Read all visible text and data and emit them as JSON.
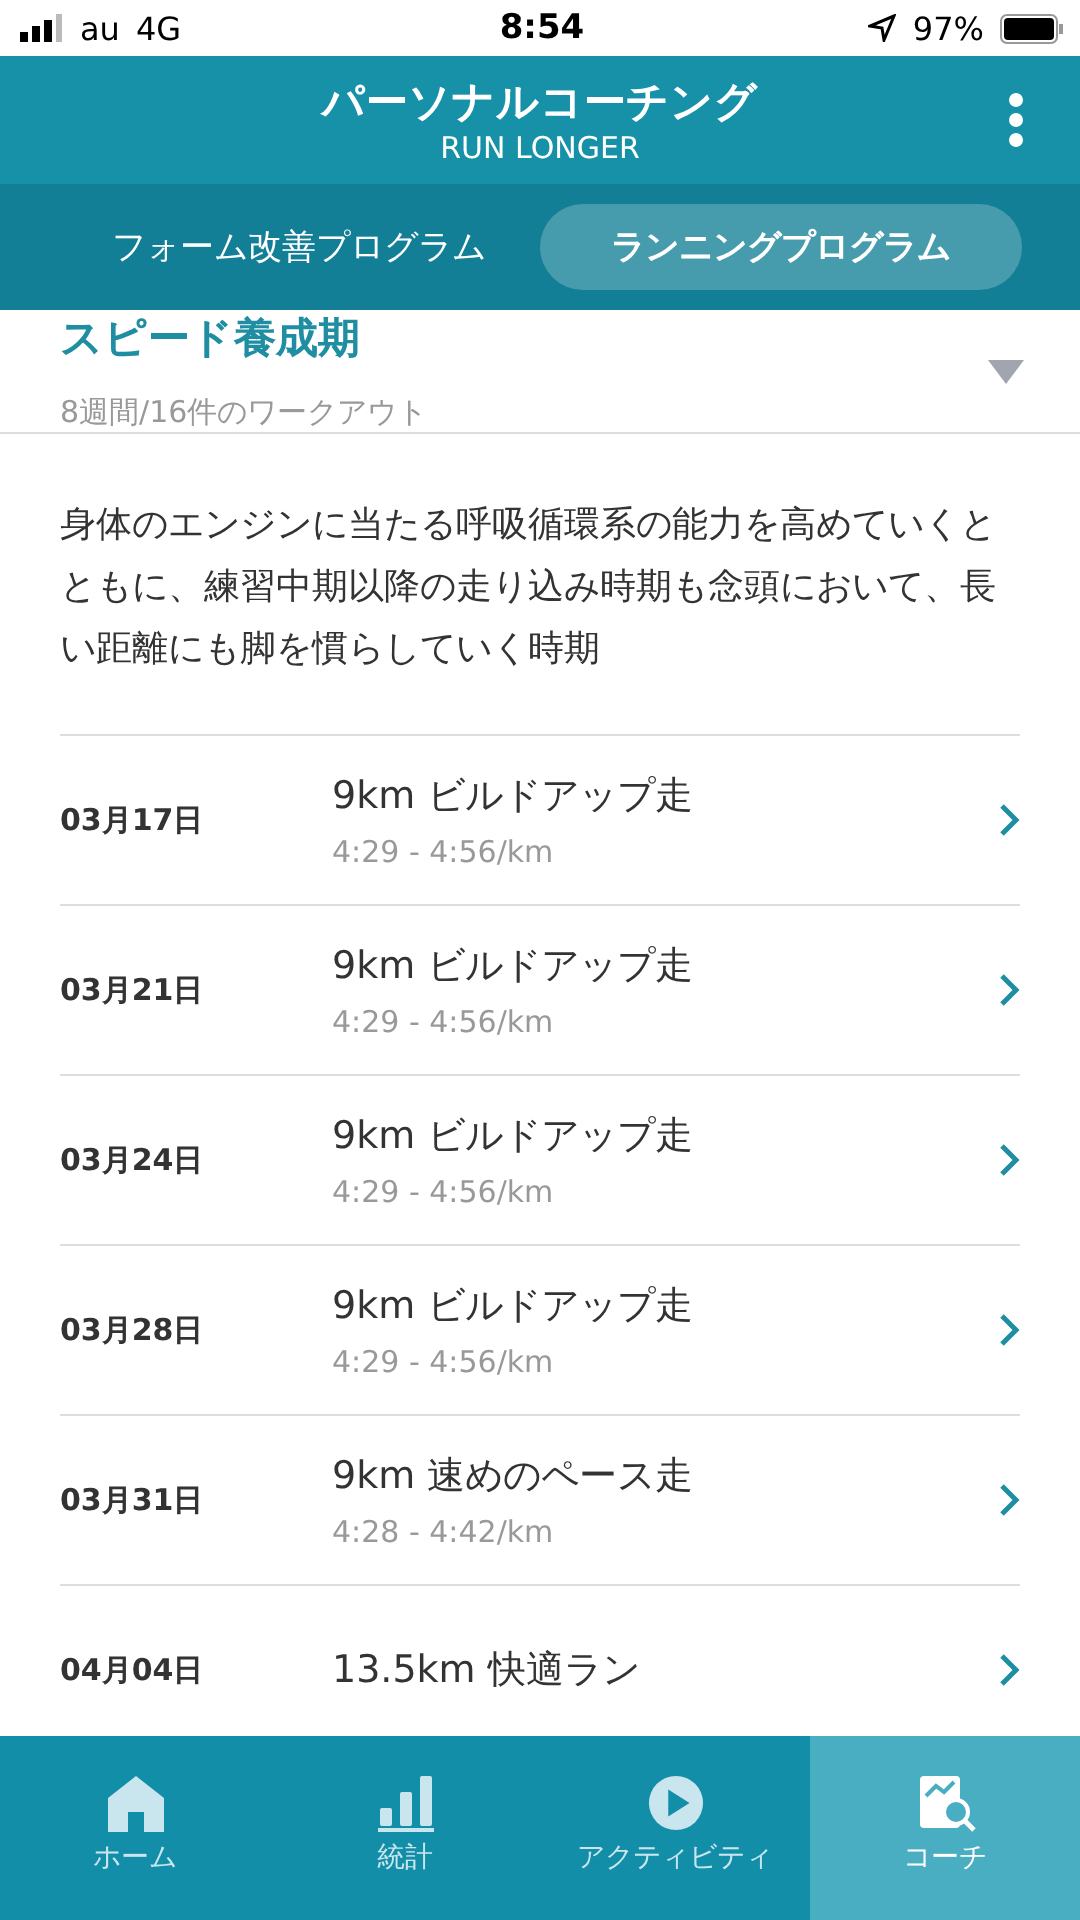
{
  "status_bar": {
    "carrier": "au",
    "network": "4G",
    "time": "8:54",
    "battery": "97%"
  },
  "header": {
    "title": "パーソナルコーチング",
    "subtitle": "RUN LONGER"
  },
  "tabs": [
    {
      "label": "フォーム改善プログラム",
      "selected": false
    },
    {
      "label": "ランニングプログラム",
      "selected": true
    }
  ],
  "phase": {
    "title": "スピード養成期",
    "summary": "8週間/16件のワークアウト",
    "expanded": false,
    "description": "身体のエンジンに当たる呼吸循環系の能力を高めていくとともに、練習中期以降の走り込み時期も念頭において、長い距離にも脚を慣らしていく時期"
  },
  "workouts": [
    {
      "date": "03月17日",
      "title": "9km ビルドアップ走",
      "pace": "4:29 - 4:56/km"
    },
    {
      "date": "03月21日",
      "title": "9km ビルドアップ走",
      "pace": "4:29 - 4:56/km"
    },
    {
      "date": "03月24日",
      "title": "9km ビルドアップ走",
      "pace": "4:29 - 4:56/km"
    },
    {
      "date": "03月28日",
      "title": "9km ビルドアップ走",
      "pace": "4:29 - 4:56/km"
    },
    {
      "date": "03月31日",
      "title": "9km 速めのペース走",
      "pace": "4:28 - 4:42/km"
    },
    {
      "date": "04月04日",
      "title": "13.5km 快適ラン"
    }
  ],
  "bottom_nav": [
    {
      "kind": "home",
      "label": "ホーム",
      "selected": false
    },
    {
      "kind": "stats",
      "label": "統計",
      "selected": false
    },
    {
      "kind": "activity",
      "label": "アクティビティ",
      "selected": false
    },
    {
      "kind": "coach",
      "label": "コーチ",
      "selected": true
    }
  ]
}
